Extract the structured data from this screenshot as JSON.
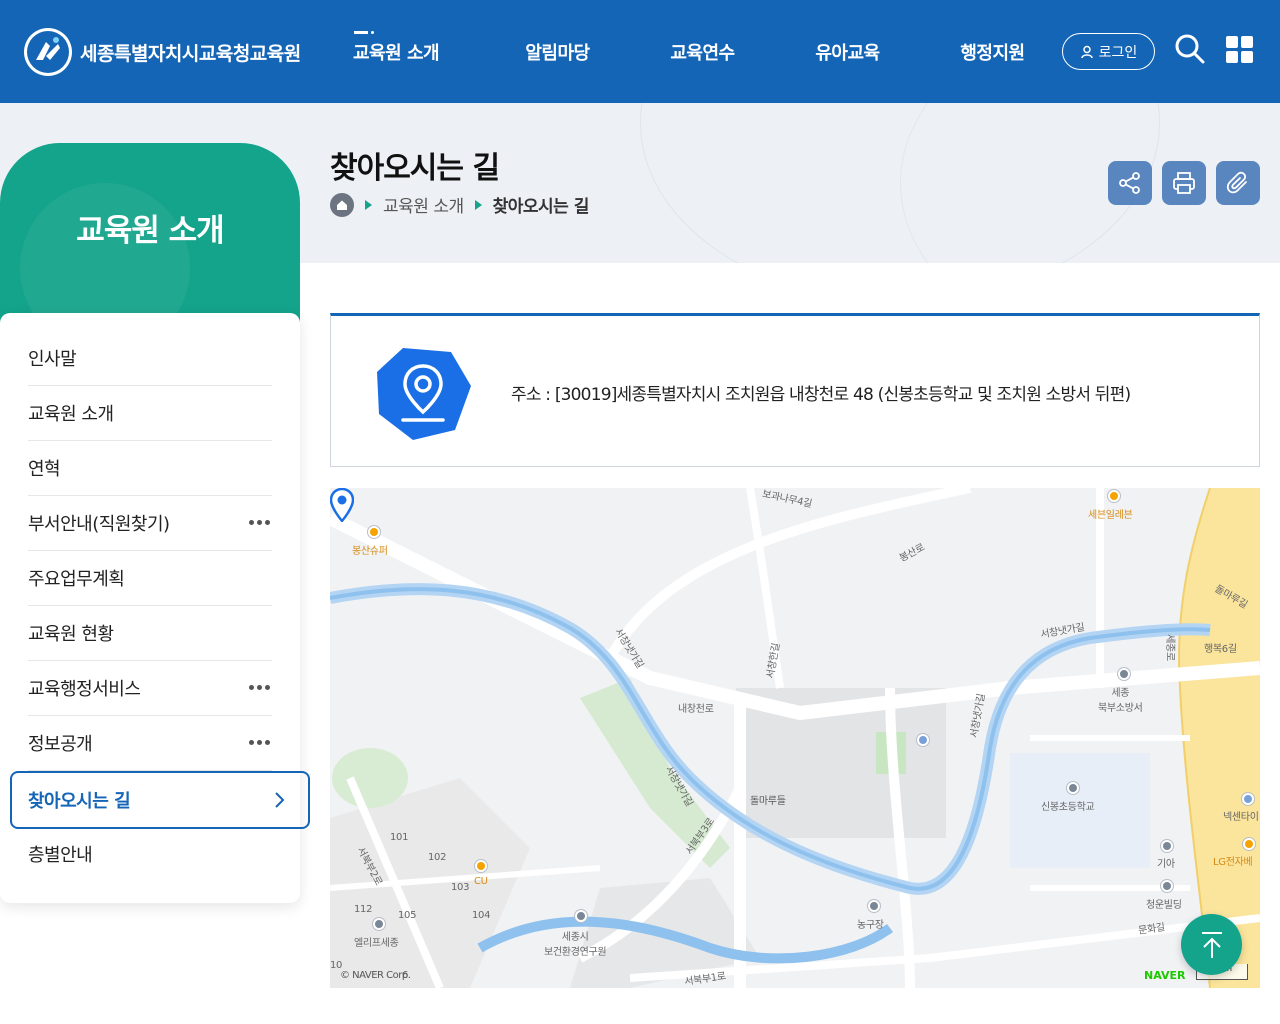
{
  "site": {
    "name": "세종특별자치시교육청교육원"
  },
  "gnb": [
    {
      "label": "교육원 소개"
    },
    {
      "label": "알림마당"
    },
    {
      "label": "교육연수"
    },
    {
      "label": "유아교육"
    },
    {
      "label": "행정지원"
    }
  ],
  "header": {
    "login_label": "로그인",
    "search_icon": "search-icon",
    "menu_icon": "grid-menu-icon"
  },
  "lnb": {
    "title": "교육원 소개",
    "items": [
      {
        "label": "인사말",
        "has_sub": false
      },
      {
        "label": "교육원 소개",
        "has_sub": false
      },
      {
        "label": "연혁",
        "has_sub": false
      },
      {
        "label": "부서안내(직원찾기)",
        "has_sub": true
      },
      {
        "label": "주요업무계획",
        "has_sub": false
      },
      {
        "label": "교육원 현황",
        "has_sub": false
      },
      {
        "label": "교육행정서비스",
        "has_sub": true
      },
      {
        "label": "정보공개",
        "has_sub": true
      },
      {
        "label": "찾아오시는 길",
        "has_sub": false,
        "active": true
      },
      {
        "label": "층별안내",
        "has_sub": false
      }
    ]
  },
  "page": {
    "title": "찾아오시는 길",
    "breadcrumb": [
      "교육원 소개",
      "찾아오시는 길"
    ]
  },
  "utils": [
    "share-icon",
    "print-icon",
    "attach-icon"
  ],
  "address": {
    "text": "주소 : [30019]세종특별자치시 조치원읍 내창천로 48 (신봉초등학교 및 조치원 소방서 뒤편)"
  },
  "map": {
    "labels": {
      "bongsan_super": "봉산슈퍼",
      "seven_eleven": "세븐일레븐",
      "bokhwanamu": "보과나무4길",
      "bongsanro": "봉산로",
      "seochang_1": "서창냇가길",
      "seochang_2": "서창냇가길",
      "seochang_3": "서창냇가길",
      "seochang_4": "서창냇가길",
      "seochang_road": "서창한길",
      "naechangcheon": "내창천로",
      "dolmaru": "돌마루들",
      "sejong_fire": "세종\n북부소방서",
      "sinbong_school": "신봉초등학교",
      "kia": "기아",
      "lg": "LG전자베",
      "cheongun": "청운빌딩",
      "munhwa": "문화길",
      "nonggujang": "농구장",
      "seobuk3": "서북부3로",
      "seobuk2": "서북부2로",
      "seobuk1": "서북부1로",
      "health_institute": "세종시\n보건환경연구원",
      "cu": "CU",
      "elif": "엘리프세종",
      "dolmaru_gil": "돌마루길",
      "haengbok6": "행복6길",
      "nexcenter": "넥센타이",
      "sejongro": "세종로",
      "n101": "101",
      "n102": "102",
      "n103": "103",
      "n104": "104",
      "n105": "105",
      "n112": "112",
      "n10": "10",
      "n6": "6"
    },
    "copyright": "© NAVER Corp.",
    "naver": "NAVER",
    "scale": "50m"
  },
  "colors": {
    "primary": "#1565b7",
    "accent": "#14a38b"
  }
}
